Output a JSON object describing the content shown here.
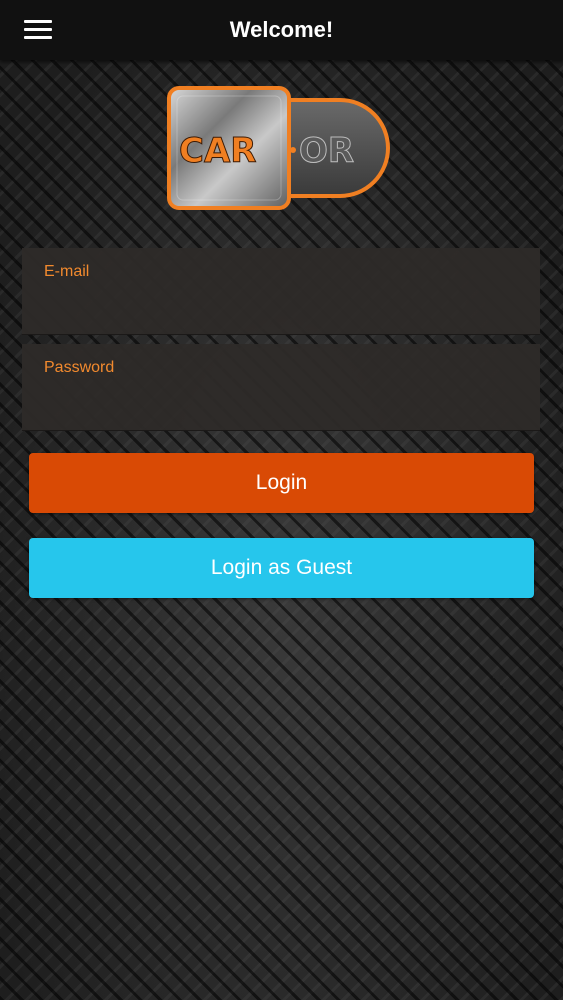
{
  "header": {
    "title": "Welcome!",
    "menu_icon": "hamburger-menu-icon"
  },
  "logo": {
    "text_left": "CAR",
    "text_right": "OR",
    "colors": {
      "accent": "#f07f22",
      "metal": "#9a9a9a"
    }
  },
  "form": {
    "email": {
      "label": "E-mail",
      "value": ""
    },
    "password": {
      "label": "Password",
      "value": ""
    }
  },
  "buttons": {
    "login_label": "Login",
    "guest_label": "Login as Guest"
  },
  "colors": {
    "top_bar": "#111111",
    "label_accent": "#f28a2e",
    "login_button": "#d94a05",
    "guest_button": "#26c6ec",
    "field_background": "#2e2b29"
  }
}
